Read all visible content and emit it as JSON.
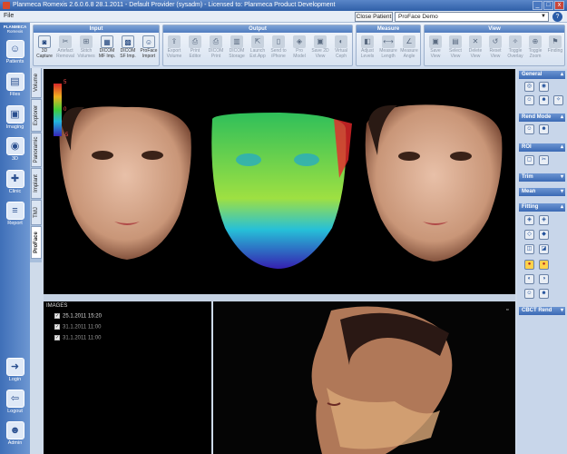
{
  "window": {
    "title": "Planmeca Romexis 2.6.0.6.8  28.1.2011 - Default Provider (sysadm) - Licensed to: Planmeca Product Development",
    "controls": [
      "_",
      "□",
      "x"
    ]
  },
  "menu": {
    "file": "File"
  },
  "topbar": {
    "close_patient": "Close Patient",
    "patient": "ProFace Demo"
  },
  "sidebar": {
    "logo": "PLANMECA",
    "logo_sub": "Romexis",
    "items": [
      {
        "label": "Patients",
        "icon": "patients-icon"
      },
      {
        "label": "Files",
        "icon": "files-icon"
      },
      {
        "label": "Imaging",
        "icon": "imaging-icon"
      },
      {
        "label": "3D",
        "icon": "3d-icon"
      },
      {
        "label": "Clinic",
        "icon": "clinic-icon"
      },
      {
        "label": "Report",
        "icon": "report-icon"
      },
      {
        "label": "Login",
        "icon": "login-icon"
      },
      {
        "label": "Logout",
        "icon": "logout-icon"
      },
      {
        "label": "Admin",
        "icon": "admin-icon"
      }
    ]
  },
  "vtabs": [
    "Volume",
    "Explorer",
    "Panoramic",
    "Implant",
    "TMJ",
    "ProFace"
  ],
  "ribbon": {
    "input": {
      "title": "Input",
      "tools": [
        "3D Capture",
        "Artefact Removal",
        "Stitch Volumes",
        "DICOM MF Imp.",
        "DICOM SF Imp.",
        "ProFace Import"
      ]
    },
    "output": {
      "title": "Output",
      "tools": [
        "Export Volume",
        "Print Editor",
        "DICOM Print",
        "DICOM Storage",
        "Launch Ext.App",
        "Send to iPhone",
        "Pro Model",
        "Save 2D View",
        "Virtual Ceph"
      ]
    },
    "measure": {
      "title": "Measure",
      "tools": [
        "Adjust Levels",
        "Measure Length",
        "Measure Angle"
      ]
    },
    "view": {
      "title": "View",
      "tools": [
        "Save View",
        "Select View",
        "Delete View",
        "Reset View",
        "Toggle Overlay",
        "Toggle Zoom",
        "Finding"
      ]
    }
  },
  "colorbar": {
    "max": "5",
    "mid": "0",
    "min": "-5"
  },
  "images_panel": {
    "label": "IMAGES",
    "rows": [
      "25.1.2011 15:20",
      "31.1.2011 11:00",
      "31.1.2011 11:00"
    ]
  },
  "right_panel": {
    "sections": [
      "General",
      "Rend Mode",
      "ROI",
      "Trim",
      "Mean",
      "Fitting",
      "CBCT Rend"
    ]
  }
}
